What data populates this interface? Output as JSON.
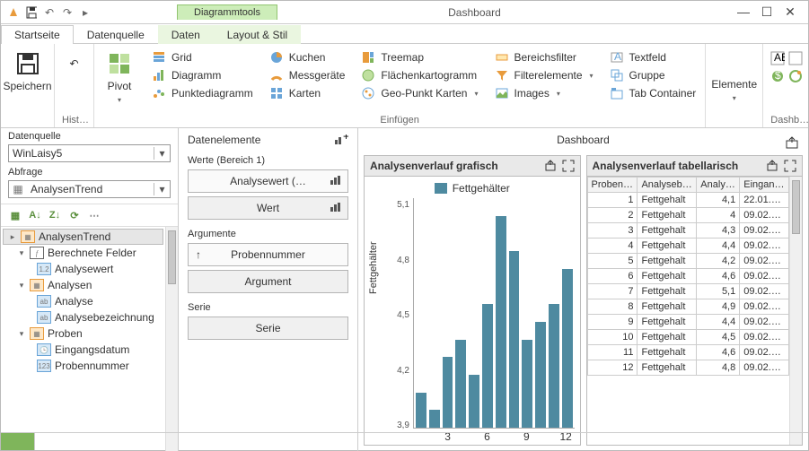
{
  "title_context": "Diagrammtools",
  "title": "Dashboard",
  "tabs": {
    "start": "Startseite",
    "daten": "Daten",
    "datenquelle": "Datenquelle",
    "layout": "Layout & Stil"
  },
  "ribbon": {
    "speichern": "Speichern",
    "hist": "Hist…",
    "pivot": "Pivot",
    "elemente": "Elemente",
    "dashb": "Dashb…",
    "einfuegen": "Einfügen",
    "grid": "Grid",
    "diagramm": "Diagramm",
    "punkte": "Punktediagramm",
    "kuchen": "Kuchen",
    "mess": "Messgeräte",
    "karten": "Karten",
    "treemap": "Treemap",
    "flachen": "Flächenkartogramm",
    "geo": "Geo-Punkt Karten",
    "bereich": "Bereichsfilter",
    "filter": "Filterelemente",
    "images": "Images",
    "textfeld": "Textfeld",
    "gruppe": "Gruppe",
    "tab": "Tab Container"
  },
  "left": {
    "datenquelle": "Datenquelle",
    "dq_val": "WinLaisy5",
    "abfrage": "Abfrage",
    "ab_val": "AnalysenTrend",
    "tree": {
      "root": "AnalysenTrend",
      "berech": "Berechnete Felder",
      "analysewert": "Analysewert",
      "analysen": "Analysen",
      "analyse": "Analyse",
      "analysebez": "Analysebezeichnung",
      "proben": "Proben",
      "eingang": "Eingangsdatum",
      "probennr": "Probennummer"
    }
  },
  "mid": {
    "title": "Datenelemente",
    "werte": "Werte (Bereich 1)",
    "analysewert": "Analysewert (…",
    "wert": "Wert",
    "argumente": "Argumente",
    "probennr": "Probennummer",
    "argument": "Argument",
    "serie_t": "Serie",
    "serie": "Serie"
  },
  "dash": {
    "title": "Dashboard",
    "p1": "Analysenverlauf grafisch",
    "p2": "Analysenverlauf tabellarisch",
    "legend": "Fettgehälter",
    "ylabel": "Fettgehälter",
    "cols": {
      "c1": "Proben…",
      "c2": "Analyseb…",
      "c3": "Analy…",
      "c4": "Eingan…"
    }
  },
  "chart_data": {
    "type": "bar",
    "title": "Analysenverlauf grafisch",
    "ylabel": "Fettgehälter",
    "xlabel": "",
    "ylim": [
      3.9,
      5.2
    ],
    "yticks": [
      5.1,
      4.8,
      4.5,
      4.2,
      3.9
    ],
    "xticks": [
      "3",
      "6",
      "9",
      "12"
    ],
    "categories": [
      1,
      2,
      3,
      4,
      5,
      6,
      7,
      8,
      9,
      10,
      11,
      12
    ],
    "series": [
      {
        "name": "Fettgehälter",
        "values": [
          4.1,
          4.0,
          4.3,
          4.4,
          4.2,
          4.6,
          5.1,
          4.9,
          4.4,
          4.5,
          4.6,
          4.8
        ]
      }
    ]
  },
  "table_rows": [
    {
      "n": 1,
      "b": "Fettgehalt",
      "v": "4,1",
      "d": "22.01.…"
    },
    {
      "n": 2,
      "b": "Fettgehalt",
      "v": "4",
      "d": "09.02.…"
    },
    {
      "n": 3,
      "b": "Fettgehalt",
      "v": "4,3",
      "d": "09.02.…"
    },
    {
      "n": 4,
      "b": "Fettgehalt",
      "v": "4,4",
      "d": "09.02.…"
    },
    {
      "n": 5,
      "b": "Fettgehalt",
      "v": "4,2",
      "d": "09.02.…"
    },
    {
      "n": 6,
      "b": "Fettgehalt",
      "v": "4,6",
      "d": "09.02.…"
    },
    {
      "n": 7,
      "b": "Fettgehalt",
      "v": "5,1",
      "d": "09.02.…"
    },
    {
      "n": 8,
      "b": "Fettgehalt",
      "v": "4,9",
      "d": "09.02.…"
    },
    {
      "n": 9,
      "b": "Fettgehalt",
      "v": "4,4",
      "d": "09.02.…"
    },
    {
      "n": 10,
      "b": "Fettgehalt",
      "v": "4,5",
      "d": "09.02.…"
    },
    {
      "n": 11,
      "b": "Fettgehalt",
      "v": "4,6",
      "d": "09.02.…"
    },
    {
      "n": 12,
      "b": "Fettgehalt",
      "v": "4,8",
      "d": "09.02.…"
    }
  ]
}
